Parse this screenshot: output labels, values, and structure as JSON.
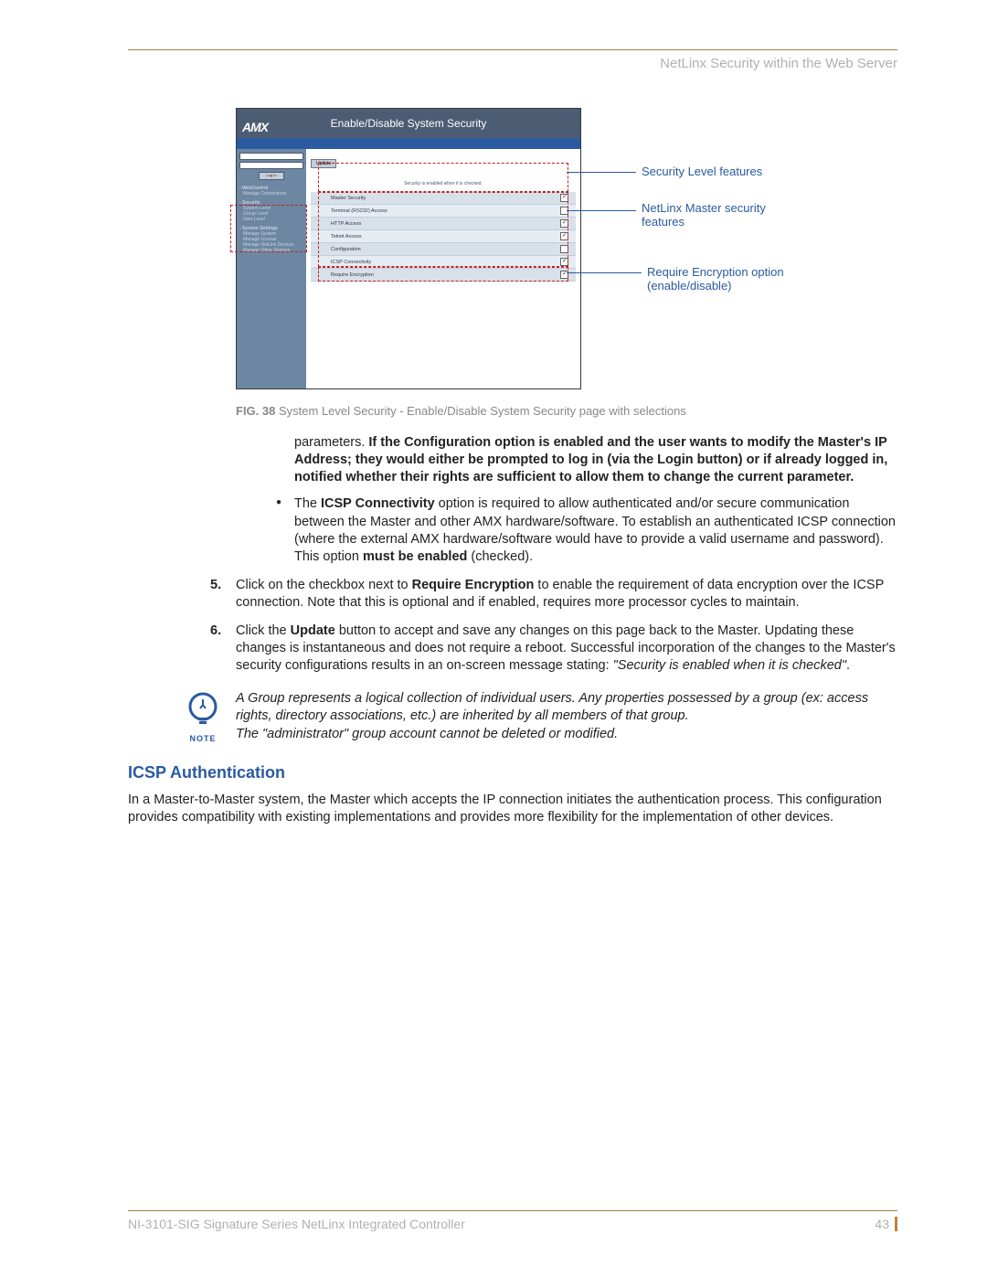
{
  "header": {
    "right_text": "NetLinx Security within the Web Server"
  },
  "figure": {
    "app_title": "Enable/Disable System Security",
    "app_logo": "AMX",
    "update_btn": "Update",
    "login_btn": "Log In",
    "hint": "Security is enabled when it is checked.",
    "side": {
      "h1": "- WebControl",
      "i1": "Manage Connections",
      "h2": "- Security",
      "i2a": "System Level",
      "i2b": "Group Level",
      "i2c": "User Level",
      "h3": "- System Settings",
      "i3a": "Manage System",
      "i3b": "Manage License",
      "i3c": "Manage NetLinx Devices",
      "i3d": "Manage Other Devices"
    },
    "rows": [
      {
        "label": "Master Security",
        "checked": true
      },
      {
        "label": "Terminal (RS232) Access",
        "checked": false
      },
      {
        "label": "HTTP Access",
        "checked": true
      },
      {
        "label": "Telnet Access",
        "checked": true
      },
      {
        "label": "Configuration",
        "checked": false
      },
      {
        "label": "ICSP Connectivity",
        "checked": true
      },
      {
        "label": "Require Encryption",
        "checked": true
      }
    ],
    "callouts": {
      "c1": "Security Level features",
      "c2": "NetLinx Master security features",
      "c3": "Require Encryption option (enable/disable)"
    },
    "caption_bold": "FIG. 38",
    "caption_text": "System Level Security - Enable/Disable System Security page with selections"
  },
  "body": {
    "p1a": "parameters. ",
    "p1b": "If the Configuration option is enabled and the user wants to modify the Master's IP Address; they would either be prompted to log in (via the Login button) or if already logged in, notified whether their rights are sufficient to allow them to change the current parameter.",
    "bullet_a1": "The ",
    "bullet_a2": "ICSP Connectivity",
    "bullet_a3": " option is required to allow authenticated and/or secure communication between the Master and other AMX hardware/software. To establish an authenticated ICSP connection (where the external AMX hardware/software would have to provide a valid username and password). This option ",
    "bullet_a4": "must be enabled",
    "bullet_a5": " (checked).",
    "step5_num": "5.",
    "step5a": "Click on the checkbox next to ",
    "step5b": "Require Encryption",
    "step5c": " to enable the requirement of data encryption over the ICSP connection. Note that this is optional and if enabled, requires more processor cycles to maintain.",
    "step6_num": "6.",
    "step6a": "Click the ",
    "step6b": "Update",
    "step6c": " button to accept and save any changes on this page back to the Master. Updating these changes is instantaneous and does not require a reboot. Successful incorporation of the changes to the Master's security configurations results in an on-screen message stating: ",
    "step6d": "\"Security is enabled when it is checked\"",
    "step6e": "."
  },
  "note": {
    "label": "NOTE",
    "line1": "A Group represents a logical collection of individual users. Any properties possessed by a group (ex: access rights, directory associations, etc.) are inherited by all members of that group.",
    "line2": "The \"administrator\" group account cannot be deleted or modified."
  },
  "section": {
    "heading": "ICSP Authentication",
    "body": "In a Master-to-Master system, the Master which accepts the IP connection initiates the authentication process. This configuration provides compatibility with existing implementations and provides more flexibility for the implementation of other devices."
  },
  "footer": {
    "left": "NI-3101-SIG Signature Series NetLinx Integrated Controller",
    "page": "43"
  }
}
